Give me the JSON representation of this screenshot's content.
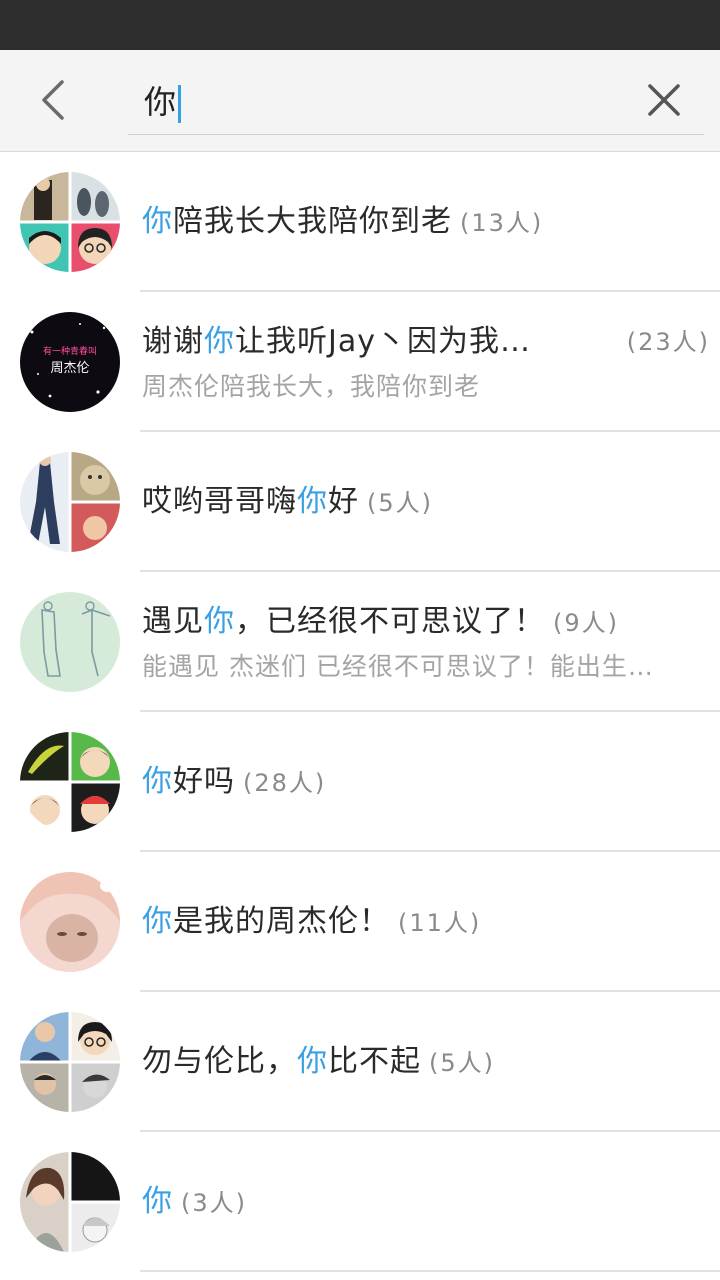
{
  "search": {
    "query": "你"
  },
  "results": [
    {
      "pre": "",
      "hl": "你",
      "post": "陪我长大我陪你到老",
      "count": "(13人)",
      "subtitle": ""
    },
    {
      "pre": "谢谢",
      "hl": "你",
      "post": "让我听Jay丶因为我…",
      "count": "(23人)",
      "subtitle": "周杰伦陪我长大，我陪你到老"
    },
    {
      "pre": "哎哟哥哥嗨",
      "hl": "你",
      "post": "好",
      "count": "(5人)",
      "subtitle": ""
    },
    {
      "pre": "遇见",
      "hl": "你",
      "post": "，已经很不可思议了！",
      "count": "(9人)",
      "subtitle": "能遇见 杰迷们   已经很不可思议了！能出生…"
    },
    {
      "pre": "",
      "hl": "你",
      "post": "好吗",
      "count": "(28人)",
      "subtitle": ""
    },
    {
      "pre": "",
      "hl": "你",
      "post": "是我的周杰伦！",
      "count": "(11人)",
      "subtitle": ""
    },
    {
      "pre": "勿与伦比，",
      "hl": "你",
      "post": "比不起",
      "count": "(5人)",
      "subtitle": ""
    },
    {
      "pre": "",
      "hl": "你",
      "post": "",
      "count": "(3人)",
      "subtitle": ""
    }
  ],
  "avatar_text": {
    "line1": "有一种青春叫",
    "line2": "周杰伦"
  },
  "colors": {
    "highlight": "#3aa0e6",
    "statusbar": "#2e2e2e",
    "header_bg": "#f4f4f4"
  },
  "icons": {
    "back": "chevron-left-icon",
    "clear": "close-icon"
  }
}
